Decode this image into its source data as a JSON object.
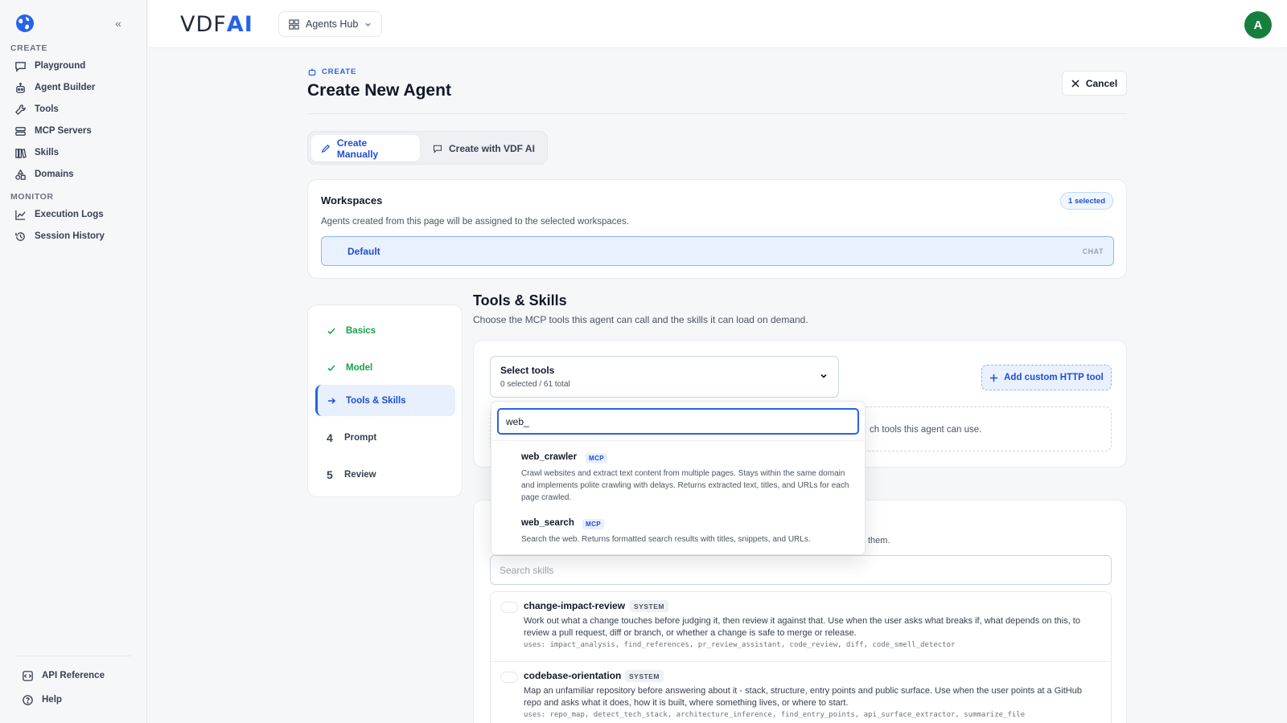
{
  "sidebar": {
    "sections": {
      "create": "CREATE",
      "monitor": "MONITOR"
    },
    "create_items": [
      {
        "label": "Playground",
        "icon": "chat-bubble-icon"
      },
      {
        "label": "Agent Builder",
        "icon": "robot-icon"
      },
      {
        "label": "Tools",
        "icon": "wrench-icon"
      },
      {
        "label": "MCP Servers",
        "icon": "server-icon"
      },
      {
        "label": "Skills",
        "icon": "book-icon"
      },
      {
        "label": "Domains",
        "icon": "shapes-icon"
      }
    ],
    "monitor_items": [
      {
        "label": "Execution Logs",
        "icon": "chart-line-icon"
      },
      {
        "label": "Session History",
        "icon": "history-icon"
      }
    ],
    "footer_items": [
      {
        "label": "API Reference",
        "icon": "code-box-icon"
      },
      {
        "label": "Help",
        "icon": "help-circle-icon"
      }
    ]
  },
  "topbar": {
    "brand_main": "VDF",
    "brand_accent": "AI",
    "hub_label": "Agents Hub",
    "avatar_initial": "A",
    "avatar_color": "#15803d"
  },
  "header": {
    "eyebrow": "CREATE",
    "title": "Create New Agent",
    "cancel_label": "Cancel"
  },
  "mode_tabs": {
    "manual": "Create Manually",
    "ai": "Create with VDF AI"
  },
  "workspaces": {
    "title": "Workspaces",
    "badge": "1 selected",
    "description": "Agents created from this page will be assigned to the selected workspaces.",
    "rows": [
      {
        "name": "Default",
        "tag": "CHAT"
      }
    ]
  },
  "steps": [
    {
      "label": "Basics",
      "state": "done",
      "marker": ""
    },
    {
      "label": "Model",
      "state": "done",
      "marker": ""
    },
    {
      "label": "Tools & Skills",
      "state": "active",
      "marker": ""
    },
    {
      "label": "Prompt",
      "state": "todo",
      "marker": "4"
    },
    {
      "label": "Review",
      "state": "todo",
      "marker": "5"
    }
  ],
  "tools": {
    "title": "Tools & Skills",
    "description": "Choose the MCP tools this agent can call and the skills it can load on demand.",
    "select_label": "Select tools",
    "select_count": "0 selected / 61 total",
    "add_http_label": "Add custom HTTP tool",
    "empty_text_tail": "ch tools this agent can use.",
    "search_value": "web_",
    "results": [
      {
        "name": "web_crawler",
        "tag": "MCP",
        "description": "Crawl websites and extract text content from multiple pages. Stays within the same domain and implements polite crawling with delays. Returns extracted text, titles, and URLs for each page crawled."
      },
      {
        "name": "web_search",
        "tag": "MCP",
        "description": "Search the web. Returns formatted search results with titles, snippets, and URLs."
      }
    ]
  },
  "skills": {
    "desc_tail": "them.",
    "search_placeholder": "Search skills",
    "items": [
      {
        "name": "change-impact-review",
        "tag": "SYSTEM",
        "description": "Work out what a change touches before judging it, then review it against that. Use when the user asks what breaks if, what depends on this, to review a pull request, diff or branch, or whether a change is safe to merge or release.",
        "uses": "uses: impact_analysis, find_references, pr_review_assistant, code_review, diff, code_smell_detector"
      },
      {
        "name": "codebase-orientation",
        "tag": "SYSTEM",
        "description": "Map an unfamiliar repository before answering about it - stack, structure, entry points and public surface. Use when the user points at a GitHub repo and asks what it does, how it is built, where something lives, or where to start.",
        "uses": "uses: repo_map, detect_tech_stack, architecture_inference, find_entry_points, api_surface_extractor, summarize_file"
      }
    ]
  },
  "colors": {
    "accent": "#2563eb",
    "success": "#16a34a",
    "text": "#111827"
  }
}
